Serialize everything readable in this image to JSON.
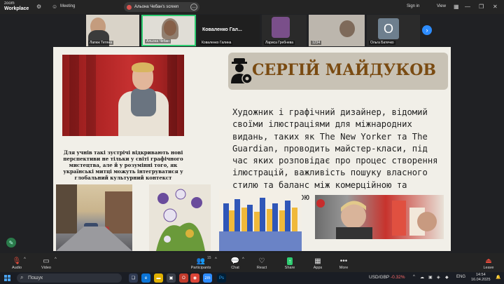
{
  "zoom": {
    "brand_small": "zoom",
    "brand_big": "Workplace",
    "meeting_label": "Meeting",
    "screen_share_label": "Альона Чебан's screen",
    "sign_in": "Sign in",
    "view": "View"
  },
  "participants": [
    {
      "name": "Лапюк Тетяна"
    },
    {
      "name": "Альона Чебан"
    },
    {
      "name": "Коваленко Галина",
      "big": "Коваленко Гал..."
    },
    {
      "name": "Лариса Гребнева"
    },
    {
      "name": "1234"
    },
    {
      "name": "Ольга Батечко",
      "initial": "O"
    }
  ],
  "slide": {
    "title": "СЕРГІЙ МАЙДУКОВ",
    "caption": "Для учнів такі зустрічі відкривають нові перспективи не тільки у світі графічного мистецтва, але й у розумінні того, як українські митці можуть інтегруватися у глобальний культурний контекст",
    "body": "Художник і графічний дизайнер, відомий своїми ілюстраціями для міжнародних видань, таких як The New Yorker та The Guardian, проводить майстер-класи, під час яких розповідає про процес створення ілюстрацій, важливість пошуку власного стилю та баланс між комерційною та творчою роботою"
  },
  "toolbar": {
    "audio": "Audio",
    "video": "Video",
    "participants": "Participants",
    "participants_count": "15",
    "chat": "Chat",
    "react": "React",
    "share": "Share",
    "apps": "Apps",
    "more": "More",
    "leave": "Leave"
  },
  "taskbar": {
    "search_placeholder": "Пошук",
    "ticker_label": "USD/GBP",
    "ticker_value": "-0.32%",
    "lang": "ENG",
    "time": "14:54",
    "date": "16.04.2025"
  },
  "colors": {
    "accent_green": "#2ecc71",
    "zoom_blue": "#2d8cff",
    "title_brown": "#7a4b12",
    "leave_red": "#e74c3c"
  }
}
